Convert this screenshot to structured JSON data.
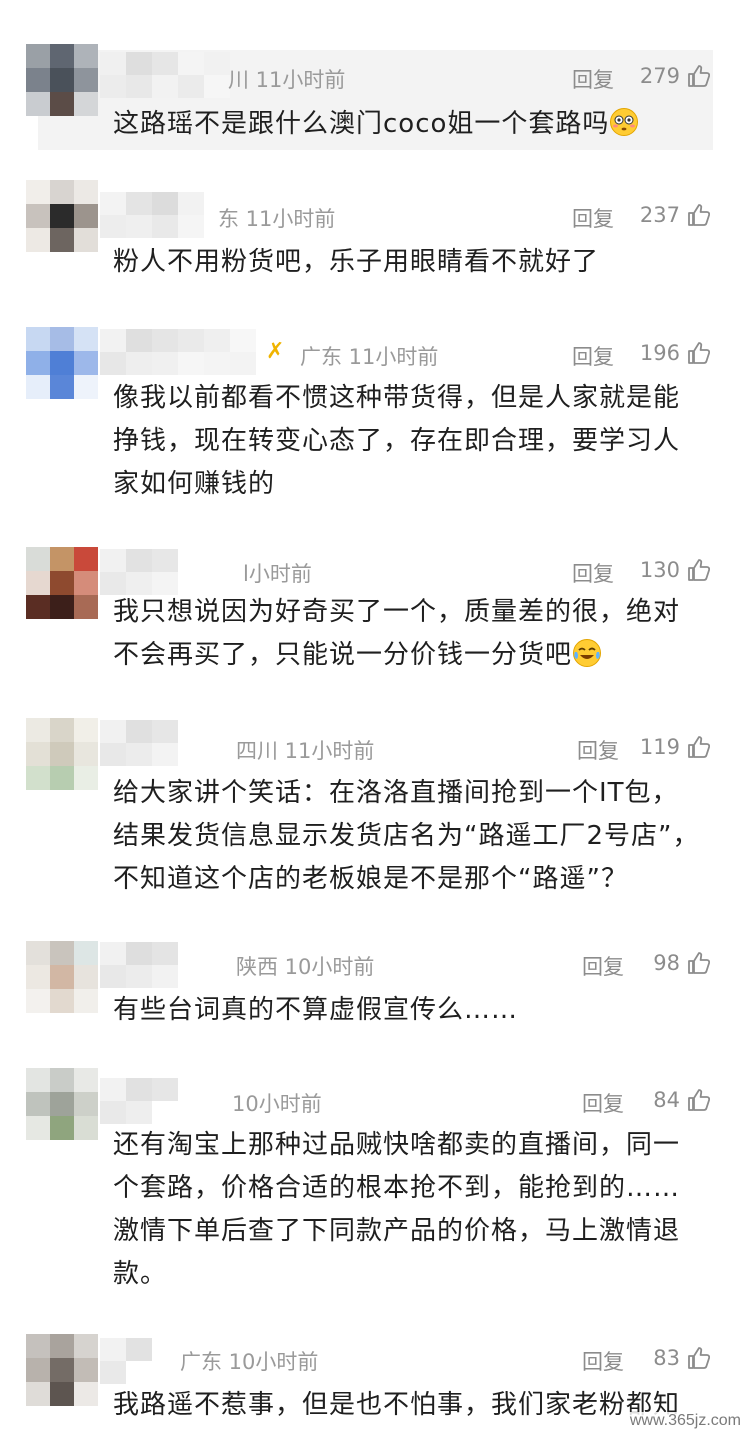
{
  "ui": {
    "reply_label": "回复"
  },
  "comments": [
    {
      "meta": "川 11小时前",
      "likes": "279",
      "text": "这路瑶不是跟什么澳门coco姐一个套路吗",
      "emoji": "flushed-emoji"
    },
    {
      "meta": "东 11小时前",
      "likes": "237",
      "text": "粉人不用粉货吧，乐子用眼睛看不就好了"
    },
    {
      "meta": "广东 11小时前",
      "likes": "196",
      "lines": [
        "像我以前都看不惯这种带货得，但是人家就是能",
        "挣钱，现在转变心态了，存在即合理，要学习人",
        "家如何赚钱的"
      ]
    },
    {
      "meta": "l小时前",
      "likes": "130",
      "lines": [
        "我只想说因为好奇买了一个，质量差的很，绝对",
        "不会再买了，只能说一分价钱一分货吧"
      ],
      "emoji": "tears-of-joy-emoji"
    },
    {
      "meta": "四川 11小时前",
      "likes": "119",
      "lines": [
        "给大家讲个笑话：在洛洛直播间抢到一个IT包，",
        "结果发货信息显示发货店名为“路遥工厂2号店”，",
        "不知道这个店的老板娘是不是那个“路遥”？"
      ]
    },
    {
      "meta": "陕西 10小时前",
      "likes": "98",
      "text": "有些台词真的不算虚假宣传么……"
    },
    {
      "meta": "10小时前",
      "likes": "84",
      "lines": [
        "还有淘宝上那种过品贼快啥都卖的直播间，同一",
        "个套路，价格合适的根本抢不到，能抢到的……",
        "激情下单后查了下同款产品的价格，马上激情退",
        "款。"
      ]
    },
    {
      "meta": "广东 10小时前",
      "likes": "83",
      "text": "我路遥不惹事，但是也不怕事，我们家老粉都知"
    }
  ],
  "watermark": "www.365jz.com",
  "colors": {
    "highlight_bg": "#f3f3f3",
    "meta_gray": "#9a9a9a",
    "body_text": "#1f1f1f",
    "verify_gold": "#f0b400"
  }
}
